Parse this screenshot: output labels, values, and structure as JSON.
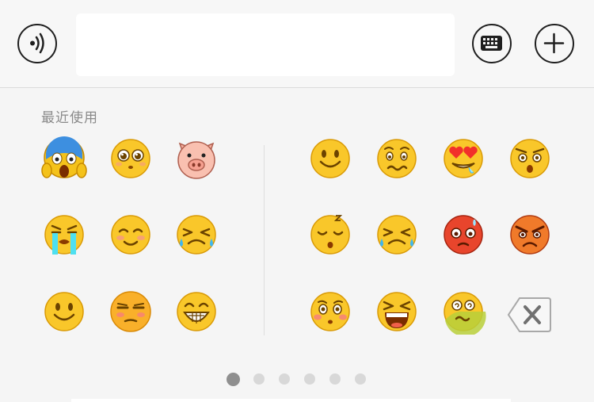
{
  "toolbar": {
    "voice_icon": "voice-icon",
    "input_value": "",
    "keyboard_icon": "keyboard-icon",
    "plus_icon": "plus-icon"
  },
  "panel": {
    "recent_label": "最近使用",
    "recent_emojis": [
      "scream-emoji",
      "pleading-emoji",
      "pig-face-emoji",
      "crying-tears-emoji",
      "blushing-smile-emoji",
      "squint-tears-emoji",
      "smile-emoji",
      "unamused-emoji",
      "grin-emoji"
    ],
    "all_emojis": [
      "smile-emoji",
      "awkward-emoji",
      "heart-eyes-emoji",
      "shocked-emoji",
      "sleepy-emoji",
      "squint-tears-emoji",
      "angry-red-emoji",
      "furious-emoji",
      "flushed-emoji",
      "screaming-emoji",
      "dizzy-sick-emoji"
    ],
    "delete_icon": "backspace-icon",
    "page_count": 6,
    "active_page": 1
  },
  "colors": {
    "emoji_yellow": "#f9c72a",
    "emoji_outline": "#d99a06",
    "angry_red": "#e8452c"
  }
}
